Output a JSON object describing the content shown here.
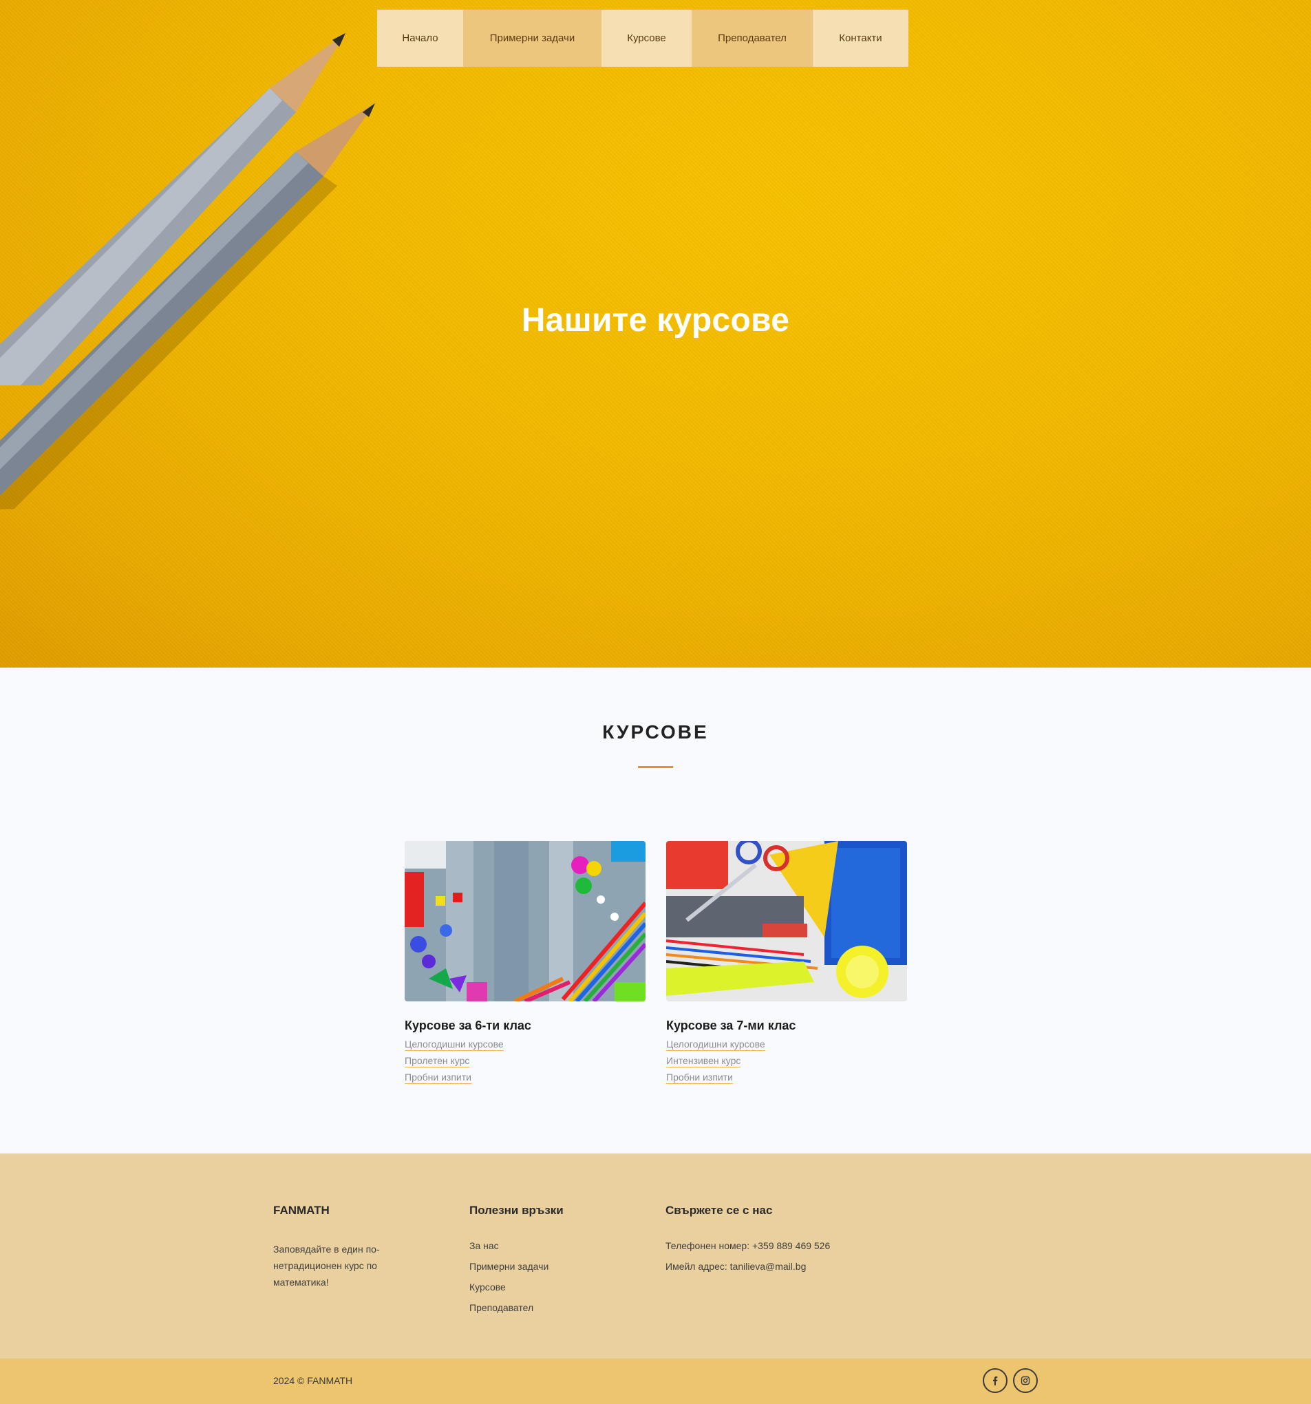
{
  "nav": {
    "items": [
      {
        "label": "Начало"
      },
      {
        "label": "Примерни задачи"
      },
      {
        "label": "Курсове"
      },
      {
        "label": "Преподавател"
      },
      {
        "label": "Контакти"
      }
    ]
  },
  "hero": {
    "title": "Нашите курсове"
  },
  "courses": {
    "heading": "КУРСОВЕ",
    "cards": [
      {
        "title": "Курсове за 6-ти клас",
        "links": [
          "Целогодишни курсове",
          "Пролетен курс",
          "Пробни изпити"
        ]
      },
      {
        "title": "Курсове за 7-ми клас",
        "links": [
          "Целогодишни курсове",
          "Интензивен курс",
          "Пробни изпити"
        ]
      }
    ]
  },
  "footer": {
    "brand": {
      "title": "FANMATH",
      "text": "Заповядайте в един по-нетрадиционен курс по математика!"
    },
    "links": {
      "title": "Полезни връзки",
      "items": [
        "За нас",
        "Примерни задачи",
        "Курсове",
        "Преподавател"
      ]
    },
    "contact": {
      "title": "Свържете се с нас",
      "phone": "Телефонен номер: +359 889 469 526",
      "email": "Имейл адрес: tanilieva@mail.bg"
    },
    "copyright": "2024 © FANMATH",
    "social": [
      "facebook-icon",
      "instagram-icon"
    ]
  },
  "colors": {
    "accent": "#f08a2d",
    "hero": "#f1b800",
    "footer": "#ebd09f",
    "bottombar": "#ecc56e",
    "nav_light": "#f5dfb3",
    "nav_dark": "#ecc67c"
  }
}
